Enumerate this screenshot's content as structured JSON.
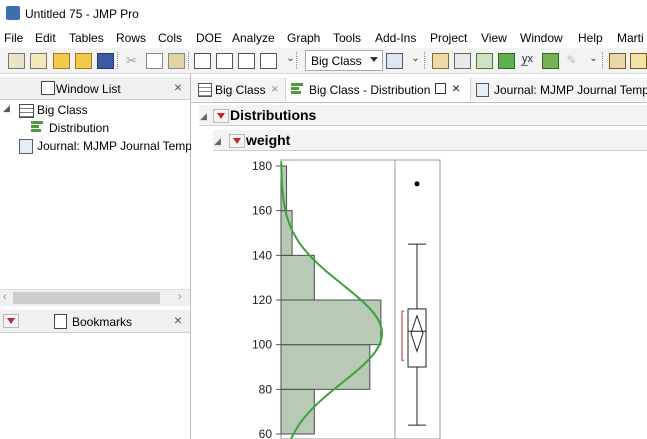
{
  "window": {
    "title": "Untitled 75 - JMP Pro"
  },
  "menu": [
    "File",
    "Edit",
    "Tables",
    "Rows",
    "Cols",
    "DOE",
    "Analyze",
    "Graph",
    "Tools",
    "Add-Ins",
    "Project",
    "View",
    "Window",
    "Help",
    "Marti"
  ],
  "toolbar": {
    "table_select": "Big Class",
    "icons": [
      "new-table-icon",
      "new-script-icon",
      "open-icon",
      "open-recent-icon",
      "save-icon",
      "cut-icon",
      "copy-icon",
      "paste-icon",
      "new-window-icon",
      "report-icon",
      "journal-icon",
      "layout-icon",
      "menu-overflow-icon",
      "table-arrow-icon",
      "data-grid-icon",
      "column-icon",
      "tabulate-icon",
      "graph-builder-icon",
      "fit-y-by-x-icon",
      "arrow-right-icon",
      "pen-icon",
      "table2-icon",
      "book-icon"
    ]
  },
  "window_list": {
    "header": "Window List",
    "items": [
      {
        "label": "Big Class",
        "icon": "data-table-icon"
      },
      {
        "label": "Distribution",
        "icon": "distribution-icon"
      },
      {
        "label": "Journal: MJMP Journal Templ",
        "icon": "journal-icon"
      }
    ]
  },
  "bookmarks": {
    "header": "Bookmarks"
  },
  "tabs": [
    {
      "label": "Big Class",
      "active": false
    },
    {
      "label": "Big Class - Distribution",
      "active": true
    },
    {
      "label": "Journal: MJMP Journal Templ",
      "active": false
    }
  ],
  "report": {
    "outline_title": "Distributions",
    "variable": "weight"
  },
  "chart_data": {
    "type": "bar",
    "orientation": "horizontal histogram",
    "bins": [
      {
        "from": 60,
        "to": 80,
        "count": 3
      },
      {
        "from": 80,
        "to": 100,
        "count": 8
      },
      {
        "from": 100,
        "to": 120,
        "count": 9
      },
      {
        "from": 120,
        "to": 140,
        "count": 3
      },
      {
        "from": 140,
        "to": 160,
        "count": 1
      },
      {
        "from": 160,
        "to": 180,
        "count": 0.5
      }
    ],
    "yticks": [
      60,
      80,
      100,
      120,
      140,
      160,
      180
    ],
    "ylim": [
      60,
      180
    ],
    "normal_curve": {
      "mean": 105,
      "sd": 22
    },
    "boxplot": {
      "min": 64,
      "q1": 90,
      "median": 106,
      "q3": 116,
      "max": 145,
      "mean": 105,
      "outliers": [
        172
      ]
    },
    "colors": {
      "bar_fill": "#b8c9b6",
      "bar_edge": "#4d4d4d",
      "curve": "#3aa33a",
      "bracket": "#c2282a"
    }
  }
}
